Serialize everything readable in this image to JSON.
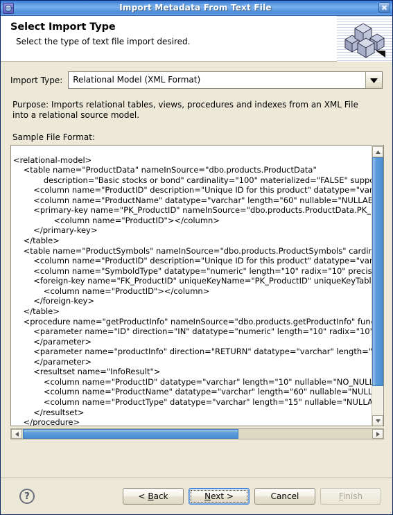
{
  "window": {
    "title": "Import Metadata From Text File",
    "app_icon": "eclipse-wizard-icon",
    "close_label": "☒"
  },
  "header": {
    "title": "Select Import Type",
    "subtitle": "Select the type of text file import desired.",
    "banner_icon": "cubes-icon"
  },
  "form": {
    "import_type_label": "Import Type:",
    "import_type_value": "Relational Model (XML Format)",
    "import_type_options": [
      "Relational Model (XML Format)"
    ],
    "dropdown_icon": "chevron-down-icon",
    "purpose_text": "Purpose: Imports relational tables, views, procedures and indexes from an XML File into a relational source model.",
    "sample_label": "Sample File Format:"
  },
  "sample": {
    "content": "<relational-model>\n    <table name=\"ProductData\" nameInSource=\"dbo.products.ProductData\"\n            description=\"Basic stocks or bond\" cardinality=\"100\" materialized=\"FALSE\" suppo\n        <column name=\"ProductID\" description=\"Unique ID for this product\" datatype=\"varch\n        <column name=\"ProductName\" datatype=\"varchar\" length=\"60\" nullable=\"NULLABLE\n        <primary-key name=\"PK_ProductID\" nameInSource=\"dbo.products.ProductData.PK_P\n                <column name=\"ProductID\"></column>\n        </primary-key>\n    </table>\n    <table name=\"ProductSymbols\" nameInSource=\"dbo.products.ProductSymbols\" cardin\n        <column name=\"ProductID\" description=\"Unique ID for this product\" datatype=\"varch\n        <column name=\"SymboldType\" datatype=\"numeric\" length=\"10\" radix=\"10\" precision\n        <foreign-key name=\"FK_ProductID\" uniqueKeyName=\"PK_ProductID\" uniqueKeyTableN\n            <column name=\"ProductID\"></column>\n        </foreign-key>\n    </table>\n    <procedure name=\"getProductInfo\" nameInSource=\"dbo.products.getProductInfo\" funct\n        <parameter name=\"ID\" direction=\"IN\" datatype=\"numeric\" length=\"10\" radix=\"10\" p\n        </parameter>\n        <parameter name=\"productInfo\" direction=\"RETURN\" datatype=\"varchar\" length=\"98\n        </parameter>\n        <resultset name=\"InfoResult\">\n            <column name=\"ProductID\" datatype=\"varchar\" length=\"10\" nullable=\"NO_NULLS\"\n            <column name=\"ProductName\" datatype=\"varchar\" length=\"60\" nullable=\"NULLAB\n            <column name=\"ProductType\" datatype=\"varchar\" length=\"15\" nullable=\"NULLABL\n        </resultset>\n    </procedure>\n    <index name=\"ProductIDIndex\" autoupdate=\"false\" nullable=\"false\" unique=\"true\">\n        <column name=\"ProductID\" tableName=\"ProductData\" />\n    </index>\n</relational-model>",
    "vertical_scrollbar": {
      "up_icon": "chevron-up-icon",
      "down_icon": "chevron-down-icon"
    },
    "horizontal_scrollbar": {
      "left_icon": "chevron-left-icon",
      "right_icon": "chevron-right-icon"
    }
  },
  "footer": {
    "help_label": "?",
    "buttons": [
      {
        "id": "back",
        "label": "< Back",
        "mnemonic": "B",
        "state": "enabled"
      },
      {
        "id": "next",
        "label": "Next >",
        "mnemonic": "N",
        "state": "focused"
      },
      {
        "id": "cancel",
        "label": "Cancel",
        "mnemonic": "",
        "state": "enabled"
      },
      {
        "id": "finish",
        "label": "Finish",
        "mnemonic": "F",
        "state": "disabled"
      }
    ]
  },
  "colors": {
    "dialog_background": "#ece9d8",
    "title_blue": "#5e9ce4",
    "scrollbar_thumb": "#5b9bd9",
    "focus_border": "#3f7ed6",
    "text": "#000000"
  }
}
